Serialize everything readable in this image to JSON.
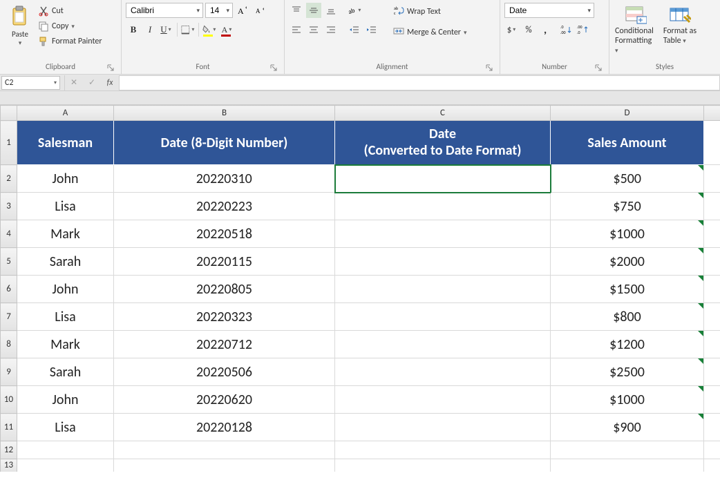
{
  "ribbon": {
    "clipboard": {
      "label": "Clipboard",
      "paste": "Paste",
      "cut": "Cut",
      "copy": "Copy",
      "format_painter": "Format Painter"
    },
    "font": {
      "label": "Font",
      "font_name": "Calibri",
      "font_size": "14",
      "bold": "B",
      "italic": "I",
      "underline": "U"
    },
    "alignment": {
      "label": "Alignment",
      "wrap_text": "Wrap Text",
      "merge_center": "Merge & Center"
    },
    "number": {
      "label": "Number",
      "format": "Date",
      "currency": "$",
      "percent": "%",
      "comma": ","
    },
    "styles": {
      "label": "Styles",
      "conditional_formatting_l1": "Conditional",
      "conditional_formatting_l2": "Formatting",
      "format_as_table_l1": "Format as",
      "format_as_table_l2": "Table"
    }
  },
  "formula_bar": {
    "name_box": "C2",
    "formula": ""
  },
  "sheet": {
    "columns": [
      "A",
      "B",
      "C",
      "D"
    ],
    "headers": {
      "A": "Salesman",
      "B": "Date (8-Digit Number)",
      "C": "Date\n(Converted to Date Format)",
      "D": "Sales Amount"
    },
    "rows": [
      {
        "n": 2,
        "A": "John",
        "B": "20220310",
        "C": "",
        "D": "$500"
      },
      {
        "n": 3,
        "A": "Lisa",
        "B": "20220223",
        "C": "",
        "D": "$750"
      },
      {
        "n": 4,
        "A": "Mark",
        "B": "20220518",
        "C": "",
        "D": "$1000"
      },
      {
        "n": 5,
        "A": "Sarah",
        "B": "20220115",
        "C": "",
        "D": "$2000"
      },
      {
        "n": 6,
        "A": "John",
        "B": "20220805",
        "C": "",
        "D": "$1500"
      },
      {
        "n": 7,
        "A": "Lisa",
        "B": "20220323",
        "C": "",
        "D": "$800"
      },
      {
        "n": 8,
        "A": "Mark",
        "B": "20220712",
        "C": "",
        "D": "$1200"
      },
      {
        "n": 9,
        "A": "Sarah",
        "B": "20220506",
        "C": "",
        "D": "$2500"
      },
      {
        "n": 10,
        "A": "John",
        "B": "20220620",
        "C": "",
        "D": "$1000"
      },
      {
        "n": 11,
        "A": "Lisa",
        "B": "20220128",
        "C": "",
        "D": "$900"
      }
    ],
    "extra_row_labels": [
      "12",
      "13"
    ],
    "selected_cell": "C2"
  }
}
